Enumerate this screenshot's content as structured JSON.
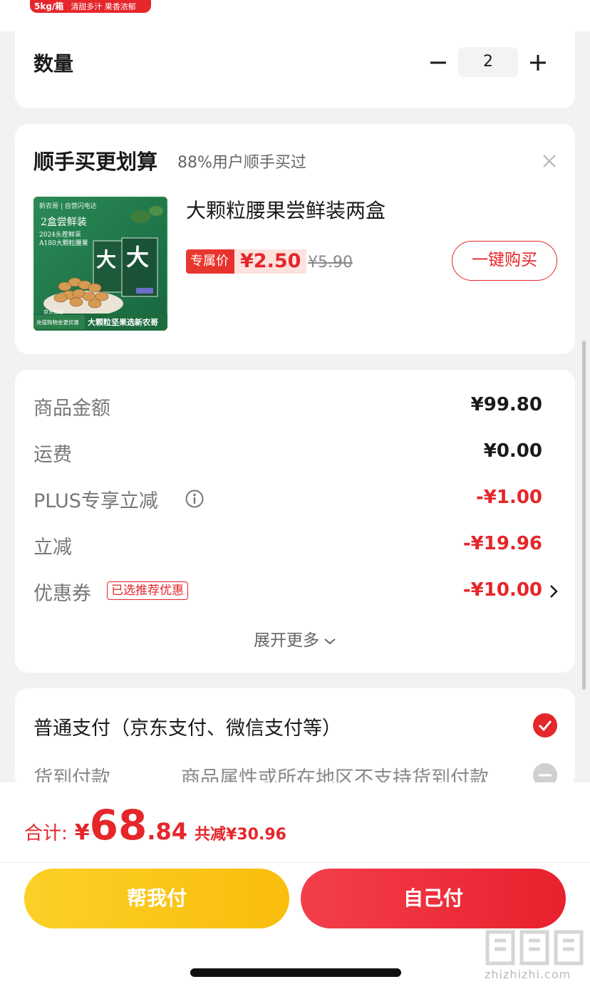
{
  "banner": {
    "weight": "5kg/箱",
    "slogan": "清甜多汁 果香浓郁"
  },
  "quantity": {
    "label": "数量",
    "value": "2"
  },
  "addon": {
    "title": "顺手买更划算",
    "subtitle": "88%用户顺手买过",
    "product": {
      "name": "大颗粒腰果尝鲜装两盒",
      "tag_label": "专属价",
      "price": "¥2.50",
      "original_price": "¥5.90",
      "button": "一键购买",
      "image_text": {
        "brand": "新农哥 | 自营闪电达",
        "line1": "2盒尝鲜装",
        "line2": "2024头茬鲜采",
        "line3": "A180大颗粒腰果",
        "big_char": "大",
        "footer_left": "充值购物金更优惠",
        "footer_right": "大颗粒坚果选新农哥",
        "small": "京东自营"
      }
    }
  },
  "summary": {
    "rows": [
      {
        "label": "商品金额",
        "value": "¥99.80"
      },
      {
        "label": "运费",
        "value": "¥0.00"
      },
      {
        "label": "PLUS专享立减",
        "value": "-¥1.00"
      },
      {
        "label": "立减",
        "value": "-¥19.96"
      },
      {
        "label": "优惠券",
        "badge": "已选推荐优惠",
        "value": "-¥10.00"
      }
    ],
    "expand": "展开更多"
  },
  "payment": {
    "option1": "普通支付（京东支付、微信支付等）",
    "option2": "货到付款",
    "option2_note": "商品属性或所在地区不支持货到付款"
  },
  "footer": {
    "total_label": "合计:",
    "currency": "¥",
    "total_int": "68",
    "total_dec": ".84",
    "saved": "共减¥30.96",
    "help_pay": "帮我付",
    "self_pay": "自己付"
  },
  "watermark": {
    "text": "zhizhizhi.com"
  },
  "colors": {
    "accent": "#e5262a",
    "yellow": "#f9bd0d",
    "green": "#1f7a4a"
  }
}
